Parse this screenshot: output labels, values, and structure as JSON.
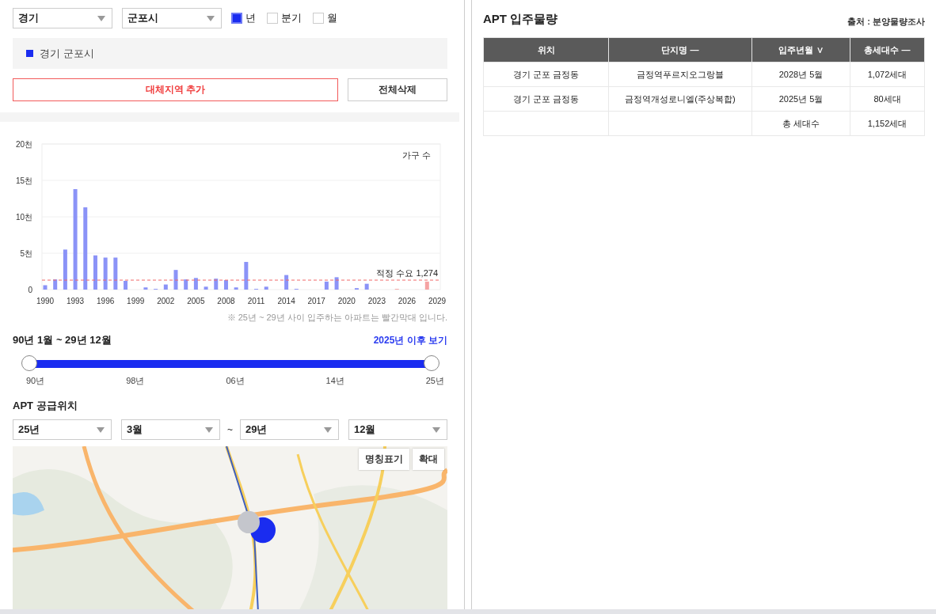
{
  "filters": {
    "selects": [
      {
        "value": "경기"
      },
      {
        "value": "군포시"
      }
    ],
    "periods": [
      {
        "label": "년",
        "checked": true
      },
      {
        "label": "분기",
        "checked": false
      },
      {
        "label": "월",
        "checked": false
      }
    ]
  },
  "regions": [
    {
      "label": "경기 군포시",
      "color": "#1a2cf0"
    }
  ],
  "buttons": [
    {
      "label": "대체지역 추가",
      "kind": "primary"
    },
    {
      "label": "전체삭제",
      "kind": "plain"
    }
  ],
  "chart_data": {
    "type": "bar",
    "ylabel": "가구 수",
    "categories": [
      "1990",
      null,
      null,
      "1993",
      null,
      null,
      "1996",
      null,
      null,
      "1999",
      null,
      null,
      "2002",
      null,
      null,
      "2005",
      null,
      null,
      "2008",
      null,
      null,
      "2011",
      null,
      null,
      "2014",
      null,
      null,
      "2017",
      null,
      null,
      "2020",
      null,
      null,
      "2023",
      null,
      null,
      "2026",
      null,
      null,
      "2029"
    ],
    "grid": true,
    "series": [
      {
        "color": "#8b93f7",
        "values": [
          0.6,
          1.4,
          5.5,
          13.8,
          11.3,
          4.7,
          4.4,
          4.4,
          1.2,
          0,
          0.3,
          0.1,
          0.7,
          2.7,
          1.4,
          1.6,
          0.4,
          1.5,
          1.3,
          0.3,
          3.8,
          0.1,
          0.4,
          0,
          2.0,
          0.1,
          0,
          0,
          1.1,
          1.7,
          0,
          0.2,
          0.8,
          0,
          0,
          null,
          null,
          null,
          null,
          null
        ]
      },
      {
        "color": "#f5a3a3",
        "values": [
          null,
          null,
          null,
          null,
          null,
          null,
          null,
          null,
          null,
          null,
          null,
          null,
          null,
          null,
          null,
          null,
          null,
          null,
          null,
          null,
          null,
          null,
          null,
          null,
          null,
          null,
          null,
          null,
          null,
          null,
          null,
          null,
          null,
          null,
          null,
          0.1,
          0,
          0,
          1.1,
          0
        ]
      }
    ],
    "ylim": [
      0,
      20
    ],
    "yticks": [
      {
        "value": 0,
        "label": "0"
      },
      {
        "value": 5,
        "label": "5천"
      },
      {
        "value": 10,
        "label": "10천"
      },
      {
        "value": 15,
        "label": "15천"
      },
      {
        "value": 20,
        "label": "20천"
      }
    ],
    "ref_lines": [
      {
        "axis": "y",
        "value": 1.3,
        "label": "적정 수요 1,274",
        "color": "#f06a6a"
      }
    ]
  },
  "chart_note": "※ 25년 ~ 29년 사이 입주하는 아파트는 빨간막대 입니다.",
  "range": {
    "label": "90년 1월 ~ 29년 12월",
    "link": "2025년 이후 보기",
    "thumbs": [
      {
        "level": 0
      },
      {
        "level": 1
      }
    ],
    "ticks": [
      "90년",
      "98년",
      "06년",
      "14년",
      "25년"
    ]
  },
  "supply": {
    "title": "APT 공급위치",
    "selects": [
      {
        "value": "25년"
      },
      {
        "value": "3월"
      },
      {
        "value": "29년"
      },
      {
        "value": "12월"
      }
    ],
    "separator": "~",
    "map": {
      "kind": "picture",
      "buttons": [
        "명칭표기",
        "확대"
      ]
    }
  },
  "table": {
    "title": "APT 입주물량",
    "source": "출처 : 분양물량조사",
    "columns": [
      {
        "label": "위치"
      },
      {
        "label": "단지명",
        "sort": "—"
      },
      {
        "label": "입주년월",
        "sort": "∨"
      },
      {
        "label": "총세대수",
        "sort": "—"
      }
    ],
    "rows": [
      [
        "경기 군포 금정동",
        "금정역푸르지오그랑블",
        "2028년 5월",
        "1,072세대"
      ],
      [
        "경기 군포 금정동",
        "금정역개성로니엘(주상복합)",
        "2025년 5월",
        "80세대"
      ]
    ],
    "total": {
      "label": "총 세대수",
      "value": "1,152세대"
    }
  }
}
